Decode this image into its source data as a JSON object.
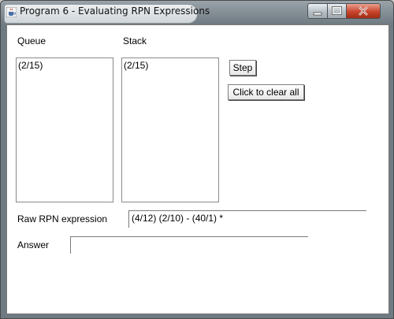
{
  "window": {
    "title": "Program 6 - Evaluating RPN Expressions",
    "icon": "java-coffee-cup-icon"
  },
  "queue": {
    "label": "Queue",
    "items": [
      "(2/15)"
    ]
  },
  "stack": {
    "label": "Stack",
    "items": [
      "(2/15)"
    ]
  },
  "buttons": {
    "step": "Step",
    "clear_all": "Click to clear all"
  },
  "raw_expression": {
    "label": "Raw RPN expression",
    "value": "(4/12)  (2/10) - (40/1) *"
  },
  "answer": {
    "label": "Answer",
    "value": ""
  },
  "colors": {
    "title_accent": "#c8452c",
    "frame": "#6f7a82"
  }
}
